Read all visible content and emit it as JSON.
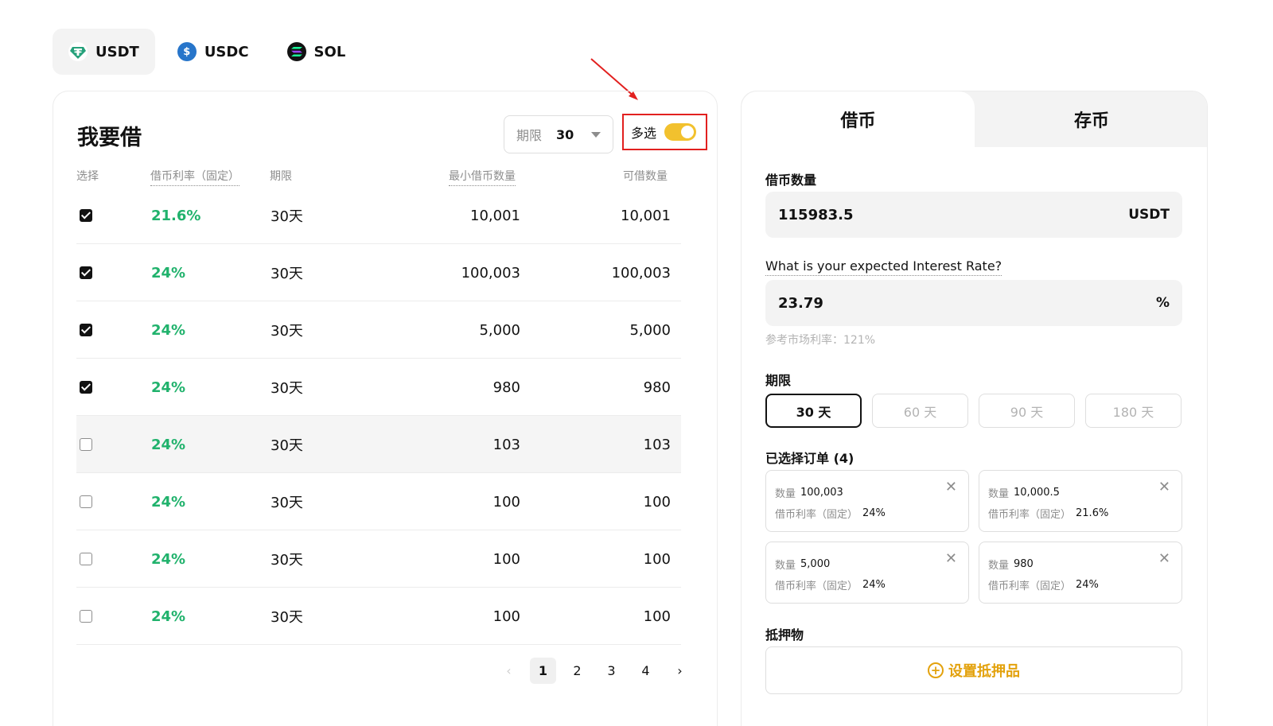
{
  "tokens": [
    {
      "label": "USDT",
      "icon": "usdt-icon",
      "active": true
    },
    {
      "label": "USDC",
      "icon": "usdc-icon",
      "active": false
    },
    {
      "label": "SOL",
      "icon": "sol-icon",
      "active": false
    }
  ],
  "borrow_panel": {
    "title": "我要借",
    "term_filter": {
      "label": "期限",
      "value": "30"
    },
    "multi_select": {
      "label": "多选",
      "enabled": true
    },
    "columns": {
      "select": "选择",
      "rate": "借币利率（固定）",
      "term": "期限",
      "min_qty": "最小借币数量",
      "available": "可借数量"
    },
    "rows": [
      {
        "checked": true,
        "rate": "21.6%",
        "term": "30天",
        "min_qty": "10,001",
        "available": "10,001"
      },
      {
        "checked": true,
        "rate": "24%",
        "term": "30天",
        "min_qty": "100,003",
        "available": "100,003"
      },
      {
        "checked": true,
        "rate": "24%",
        "term": "30天",
        "min_qty": "5,000",
        "available": "5,000"
      },
      {
        "checked": true,
        "rate": "24%",
        "term": "30天",
        "min_qty": "980",
        "available": "980"
      },
      {
        "checked": false,
        "rate": "24%",
        "term": "30天",
        "min_qty": "103",
        "available": "103"
      },
      {
        "checked": false,
        "rate": "24%",
        "term": "30天",
        "min_qty": "100",
        "available": "100"
      },
      {
        "checked": false,
        "rate": "24%",
        "term": "30天",
        "min_qty": "100",
        "available": "100"
      },
      {
        "checked": false,
        "rate": "24%",
        "term": "30天",
        "min_qty": "100",
        "available": "100"
      }
    ],
    "pagination": {
      "prev": "‹",
      "pages": [
        "1",
        "2",
        "3",
        "4"
      ],
      "current": "1",
      "next": "›"
    }
  },
  "right_panel": {
    "tabs": {
      "borrow": "借币",
      "deposit": "存币"
    },
    "amount_label": "借币数量",
    "amount_value": "115983.5",
    "amount_unit": "USDT",
    "rate_label": "What is your expected Interest Rate?",
    "rate_value": "23.79",
    "rate_unit": "%",
    "market_hint": "参考市场利率：121%",
    "term_label": "期限",
    "term_options": [
      "30 天",
      "60 天",
      "90 天",
      "180 天"
    ],
    "selected_term": "30 天",
    "selected_orders_label": "已选择订单 (4)",
    "orders": [
      {
        "qty_label": "数量",
        "qty": "100,003",
        "rate_label": "借币利率（固定）",
        "rate": "24%"
      },
      {
        "qty_label": "数量",
        "qty": "10,000.5",
        "rate_label": "借币利率（固定）",
        "rate": "21.6%"
      },
      {
        "qty_label": "数量",
        "qty": "5,000",
        "rate_label": "借币利率（固定）",
        "rate": "24%"
      },
      {
        "qty_label": "数量",
        "qty": "980",
        "rate_label": "借币利率（固定）",
        "rate": "24%"
      }
    ],
    "collateral_label": "抵押物",
    "collateral_button": "设置抵押品"
  },
  "colors": {
    "accent": "#f2c12e",
    "rate_green": "#20b26c",
    "annotation_red": "#e2201f",
    "collateral_gold": "#e3a20d"
  }
}
